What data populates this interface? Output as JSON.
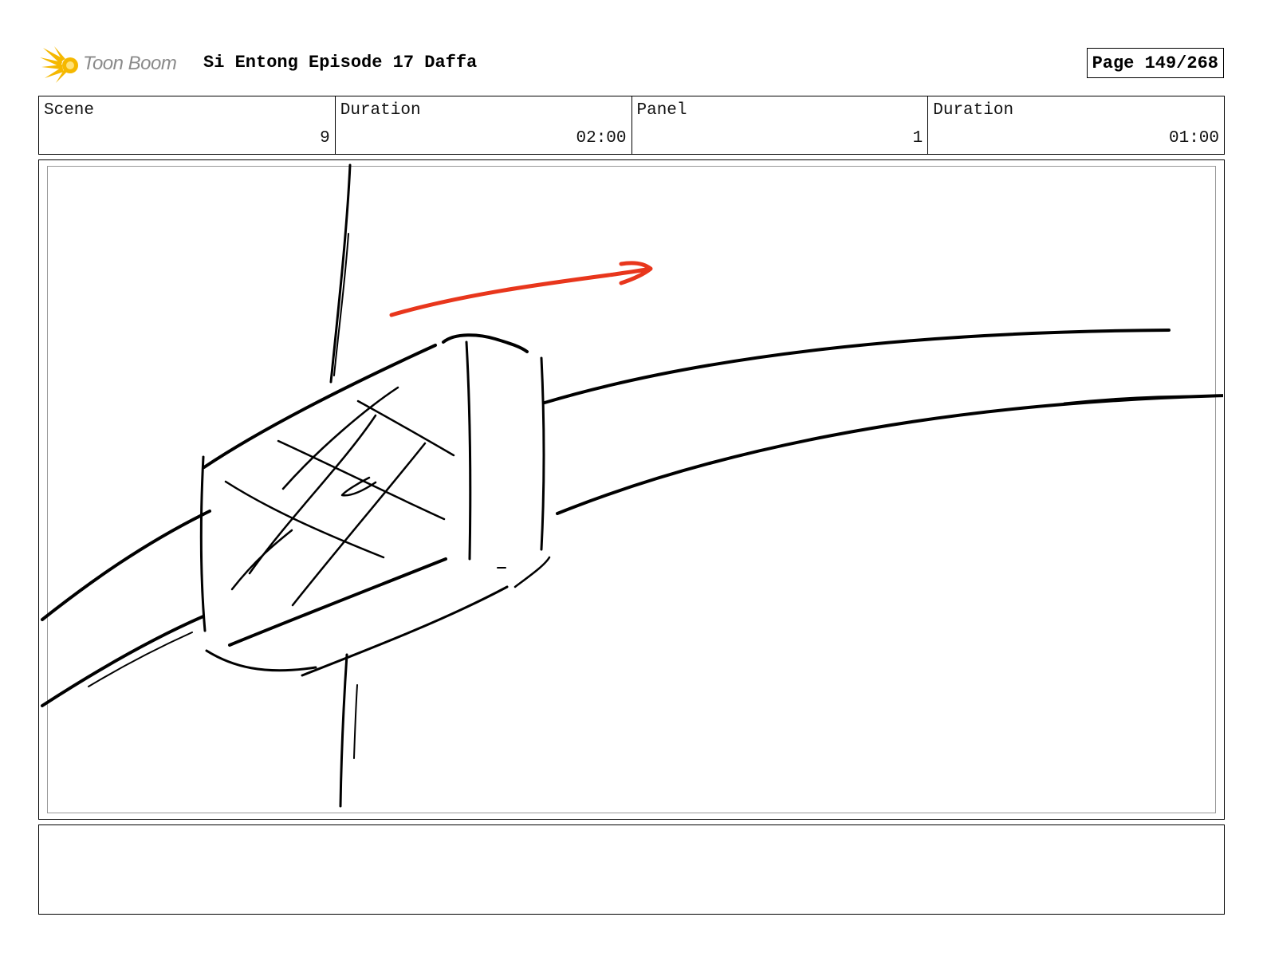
{
  "header": {
    "logo_text": "Toon Boom",
    "logo_icon": "starburst-logo-icon",
    "title": "Si Entong Episode 17 Daffa",
    "page": "Page 149/268"
  },
  "info": {
    "scene_label": "Scene",
    "scene_value": "9",
    "scene_duration_label": "Duration",
    "scene_duration_value": "02:00",
    "panel_label": "Panel",
    "panel_value": "1",
    "panel_duration_label": "Duration",
    "panel_duration_value": "01:00"
  },
  "colors": {
    "sketch_line": "#000000",
    "motion_arrow": "#e8361c",
    "logo_yellow": "#f5b800",
    "logo_text": "#8a8a8a"
  },
  "notes": {
    "text": ""
  }
}
